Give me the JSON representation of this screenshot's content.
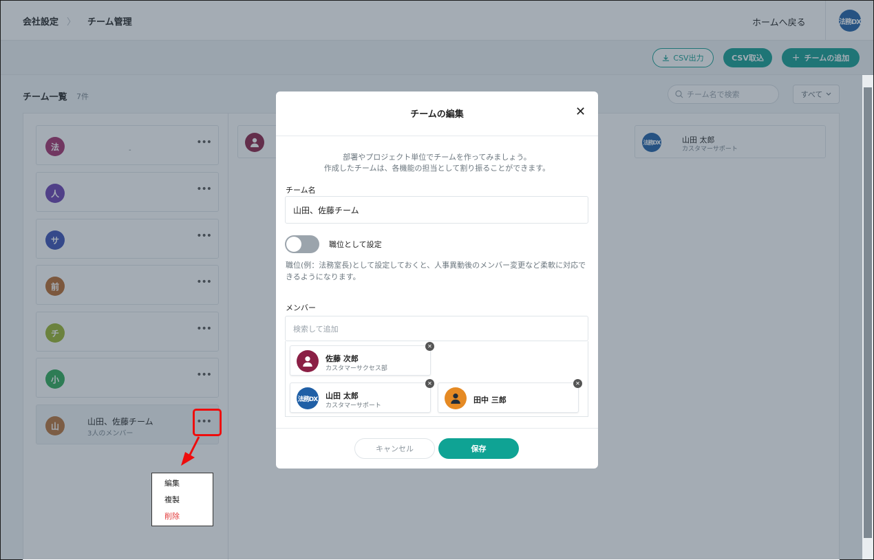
{
  "header": {
    "breadcrumb": [
      "会社設定",
      "チーム管理"
    ],
    "breadcrumb_sep": "〉",
    "home_link": "ホームへ戻る",
    "brand_logo": "法務DX"
  },
  "toolbar": {
    "csv_export": "CSV出力",
    "csv_import": "CSV取込",
    "add_team": "チームの追加",
    "add_icon": "+"
  },
  "list": {
    "title": "チーム一覧",
    "count": "7件",
    "search_placeholder": "チーム名で検索",
    "filter": "すべて",
    "teams": [
      {
        "initial": "法",
        "color": "#a52f6c",
        "name": "",
        "sub": "",
        "dash": "-"
      },
      {
        "initial": "人",
        "color": "#6a3fb0",
        "name": "",
        "sub": ""
      },
      {
        "initial": "サ",
        "color": "#3a4fb5",
        "name": "",
        "sub": ""
      },
      {
        "initial": "前",
        "color": "#b86a2e",
        "name": "",
        "sub": ""
      },
      {
        "initial": "チ",
        "color": "#9ab52e",
        "name": "",
        "sub": ""
      },
      {
        "initial": "小",
        "color": "#2eaa56",
        "name": "",
        "sub": ""
      },
      {
        "initial": "山",
        "color": "#b8733a",
        "name": "山田、佐藤チーム",
        "sub": "3人のメンバー"
      }
    ],
    "more_label": "•••"
  },
  "background_members": [
    {
      "name": "",
      "dept": "",
      "avatar": "person-icon",
      "color": "#8b1f45"
    },
    {
      "name": "山田 太郎",
      "dept": "カスタマーサポート",
      "avatar": "brand-logo",
      "color": "#1f5fa6"
    }
  ],
  "context_menu": {
    "items": [
      "編集",
      "複製",
      "削除"
    ]
  },
  "modal": {
    "title": "チームの編集",
    "close": "✕",
    "intro_line1": "部署やプロジェクト単位でチームを作ってみましょう。",
    "intro_line2": "作成したチームは、各機能の担当として割り振ることができます。",
    "team_name_label": "チーム名",
    "team_name_value": "山田、佐藤チーム",
    "toggle_label": "職位として設定",
    "toggle_on": false,
    "help_text": "職位(例：法務室長)として設定しておくと、人事異動後のメンバー変更など柔軟に対応できるようになります。",
    "members_label": "メンバー",
    "member_search_placeholder": "検索して追加",
    "members": [
      {
        "name": "佐藤 次郎",
        "dept": "カスタマーサクセス部",
        "avatar": "person-icon",
        "color": "#8b1f45"
      },
      {
        "name": "山田 太郎",
        "dept": "カスタマーサポート",
        "avatar": "brand-logo",
        "color": "#1f5fa6",
        "logo_text": "法務DX"
      },
      {
        "name": "田中 三郎",
        "dept": "",
        "avatar": "person-icon",
        "color": "#e58a24"
      }
    ],
    "remove_icon": "✕",
    "cancel_label": "キャンセル",
    "save_label": "保存"
  },
  "colors": {
    "accent": "#0fa394",
    "highlight": "#ee0d0d",
    "danger": "#e23b3b"
  }
}
